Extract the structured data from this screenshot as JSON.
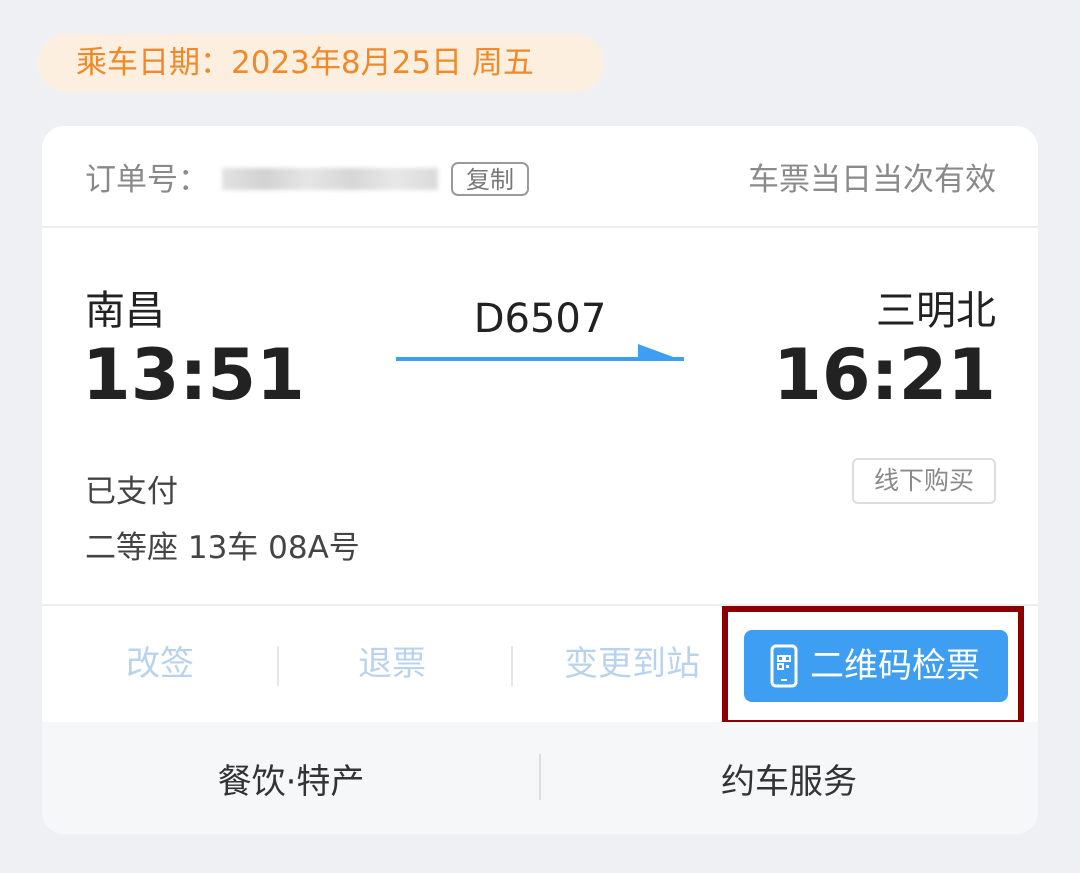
{
  "ride_date": {
    "label": "乘车日期：2023年8月25日 周五"
  },
  "order": {
    "label": "订单号：",
    "copy_label": "复制",
    "validity": "车票当日当次有效"
  },
  "trip": {
    "from_station": "南昌",
    "from_time": "13:51",
    "train_no": "D6507",
    "to_station": "三明北",
    "to_time": "16:21",
    "payment_status": "已支付",
    "seat_info": "二等座 13车 08A号",
    "purchase_channel": "线下购买"
  },
  "actions": {
    "change_ticket": "改签",
    "refund": "退票",
    "change_destination": "变更到站",
    "qr_checkin": "二维码检票",
    "qr_icon": "phone-qr-icon"
  },
  "services": {
    "food": "餐饮·特产",
    "car": "约车服务"
  },
  "colors": {
    "accent_blue": "#3e9ef2",
    "date_orange": "#ee8a2a",
    "highlight_red": "#8b0000",
    "disabled_blue": "#b9d3ed"
  }
}
